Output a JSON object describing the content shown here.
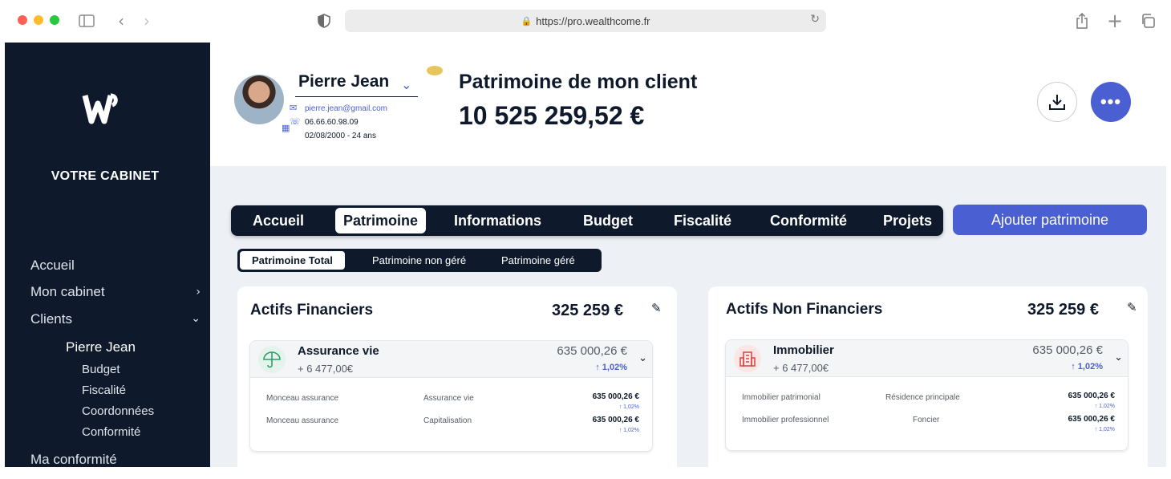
{
  "browser": {
    "url": "https://pro.wealthcome.fr"
  },
  "sidebar": {
    "cabinet_label": "VOTRE CABINET",
    "items": [
      {
        "label": "Accueil"
      },
      {
        "label": "Mon cabinet"
      },
      {
        "label": "Clients"
      },
      {
        "label": "Ma conformité"
      }
    ],
    "sub_items": [
      {
        "label": "Pierre Jean"
      },
      {
        "label": "Budget"
      },
      {
        "label": "Fiscalité"
      },
      {
        "label": "Coordonnées"
      },
      {
        "label": "Conformité"
      }
    ]
  },
  "client": {
    "name": "Pierre Jean",
    "email": "pierre.jean@gmail.com",
    "phone": "06.66.60.98.09",
    "birth": "02/08/2000 - 24 ans"
  },
  "header": {
    "title": "Patrimoine de mon client",
    "total": "10 525 259,52 €"
  },
  "tabs": [
    {
      "label": "Accueil"
    },
    {
      "label": "Patrimoine"
    },
    {
      "label": "Informations"
    },
    {
      "label": "Budget"
    },
    {
      "label": "Fiscalité"
    },
    {
      "label": "Conformité"
    },
    {
      "label": "Projets"
    }
  ],
  "add_button": "Ajouter patrimoine",
  "subtabs": [
    {
      "label": "Patrimoine Total"
    },
    {
      "label": "Patrimoine non géré"
    },
    {
      "label": "Patrimoine géré"
    }
  ],
  "cards": [
    {
      "title": "Actifs Financiers",
      "total": "325 259 €",
      "item": {
        "name": "Assurance vie",
        "sub": "+ 6 477,00€",
        "amount": "635 000,26 €",
        "pct": "1,02%",
        "icon": "umbrella-icon",
        "rows": [
          {
            "a": "Monceau assurance",
            "b": "Assurance vie",
            "amount": "635 000,26 €",
            "pct": "1,02%"
          },
          {
            "a": "Monceau assurance",
            "b": "Capitalisation",
            "amount": "635 000,26 €",
            "pct": "1,02%"
          }
        ]
      }
    },
    {
      "title": "Actifs Non Financiers",
      "total": "325 259 €",
      "item": {
        "name": "Immobilier",
        "sub": "+ 6 477,00€",
        "amount": "635 000,26 €",
        "pct": "1,02%",
        "icon": "building-icon",
        "rows": [
          {
            "a": "Immobilier patrimonial",
            "b": "Résidence principale",
            "amount": "635 000,26 €",
            "pct": "1,02%"
          },
          {
            "a": "Immobilier professionnel",
            "b": "Foncier",
            "amount": "635 000,26 €",
            "pct": "1,02%"
          }
        ]
      }
    }
  ],
  "colors": {
    "navy": "#0e1a2b",
    "accent": "#4a5fd1",
    "background": "#edf0f4"
  }
}
